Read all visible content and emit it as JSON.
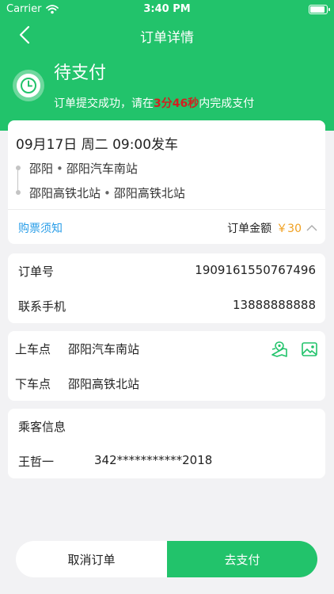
{
  "status_bar": {
    "carrier": "Carrier",
    "time": "3:40 PM"
  },
  "nav": {
    "title": "订单详情"
  },
  "header": {
    "status": "待支付",
    "tip_prefix": "订单提交成功，请在",
    "countdown": "3分46秒",
    "tip_suffix": "内完成支付"
  },
  "trip": {
    "departure": "09月17日 周二 09:00发车",
    "origin_city": "邵阳",
    "origin_station": "邵阳汽车南站",
    "dest_city": "邵阳高铁北站",
    "dest_station": "邵阳高铁北站",
    "notice": "购票须知",
    "amount_label": "订单金额",
    "amount_value": "￥30"
  },
  "order": {
    "number_label": "订单号",
    "number_value": "1909161550767496",
    "phone_label": "联系手机",
    "phone_value": "13888888888"
  },
  "stops": {
    "board_label": "上车点",
    "board_value": "邵阳汽车南站",
    "alight_label": "下车点",
    "alight_value": "邵阳高铁北站"
  },
  "passenger": {
    "title": "乘客信息",
    "name": "王哲一",
    "id_number": "342***********2018"
  },
  "actions": {
    "cancel": "取消订单",
    "pay": "去支付"
  },
  "colors": {
    "brand": "#22c36b",
    "countdown": "#d21f1f",
    "amount": "#f0a020",
    "link": "#2a9ee8"
  }
}
